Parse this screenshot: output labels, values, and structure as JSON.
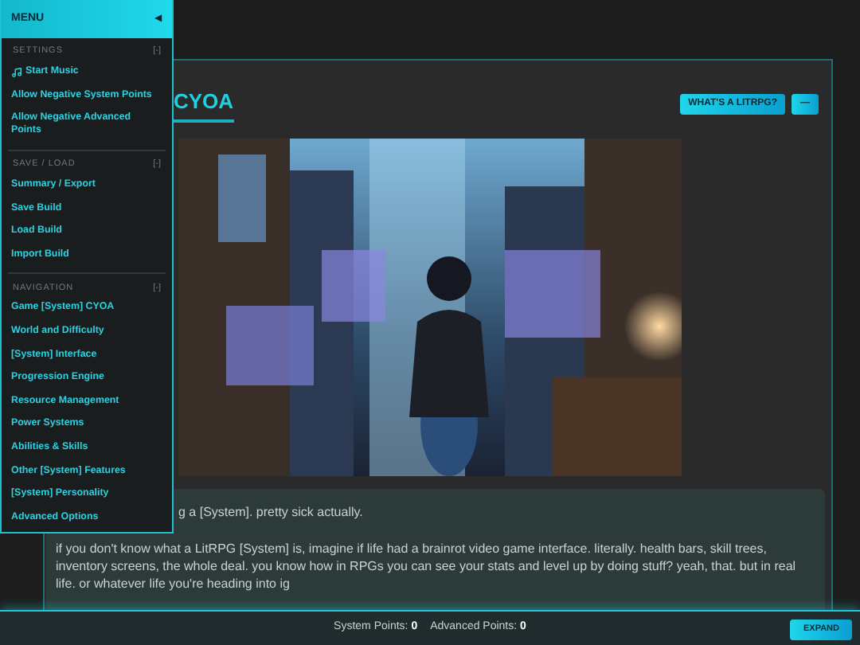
{
  "menu": {
    "title": "MENU",
    "collapse": "◀",
    "sections": [
      {
        "title": "SETTINGS",
        "toggle": "[-]",
        "items": [
          {
            "label": "Start Music",
            "kind": "music"
          },
          {
            "label": "Allow Negative System Points",
            "kind": "link"
          },
          {
            "label": "Allow Negative Advanced Points",
            "kind": "link"
          }
        ]
      },
      {
        "title": "SAVE / LOAD",
        "toggle": "[-]",
        "items": [
          {
            "label": "Summary / Export",
            "kind": "link"
          },
          {
            "label": "Save Build",
            "kind": "link"
          },
          {
            "label": "Load Build",
            "kind": "link"
          },
          {
            "label": "Import Build",
            "kind": "link"
          }
        ]
      },
      {
        "title": "NAVIGATION",
        "toggle": "[-]",
        "items": [
          {
            "label": "Game [System] CYOA",
            "kind": "link"
          },
          {
            "label": "World and Difficulty",
            "kind": "link"
          },
          {
            "label": "[System] Interface",
            "kind": "link"
          },
          {
            "label": "Progression Engine",
            "kind": "link"
          },
          {
            "label": "Resource Management",
            "kind": "link"
          },
          {
            "label": "Power Systems",
            "kind": "link"
          },
          {
            "label": "Abilities & Skills",
            "kind": "link"
          },
          {
            "label": "Other [System] Features",
            "kind": "link"
          },
          {
            "label": "[System] Personality",
            "kind": "link"
          },
          {
            "label": "Advanced Options",
            "kind": "link"
          }
        ]
      }
    ]
  },
  "header": {
    "title": "CYOA",
    "buttons": [
      "WHAT'S A LITRPG?",
      "—"
    ]
  },
  "intro": {
    "paragraphs": [
      "g a [System]. pretty sick actually.",
      "if you don't know what a LitRPG [System] is, imagine if life had a brainrot video game interface. literally. health bars, skill trees, inventory screens, the whole deal. you know how in RPGs you can see your stats and level up by doing stuff? yeah, that. but in real life. or whatever life you're heading into ig"
    ]
  },
  "status_bar": {
    "stats": [
      {
        "label": "System Points:",
        "value": "0"
      },
      {
        "label": "Advanced Points:",
        "value": "0"
      }
    ],
    "button": "EXPAND"
  }
}
